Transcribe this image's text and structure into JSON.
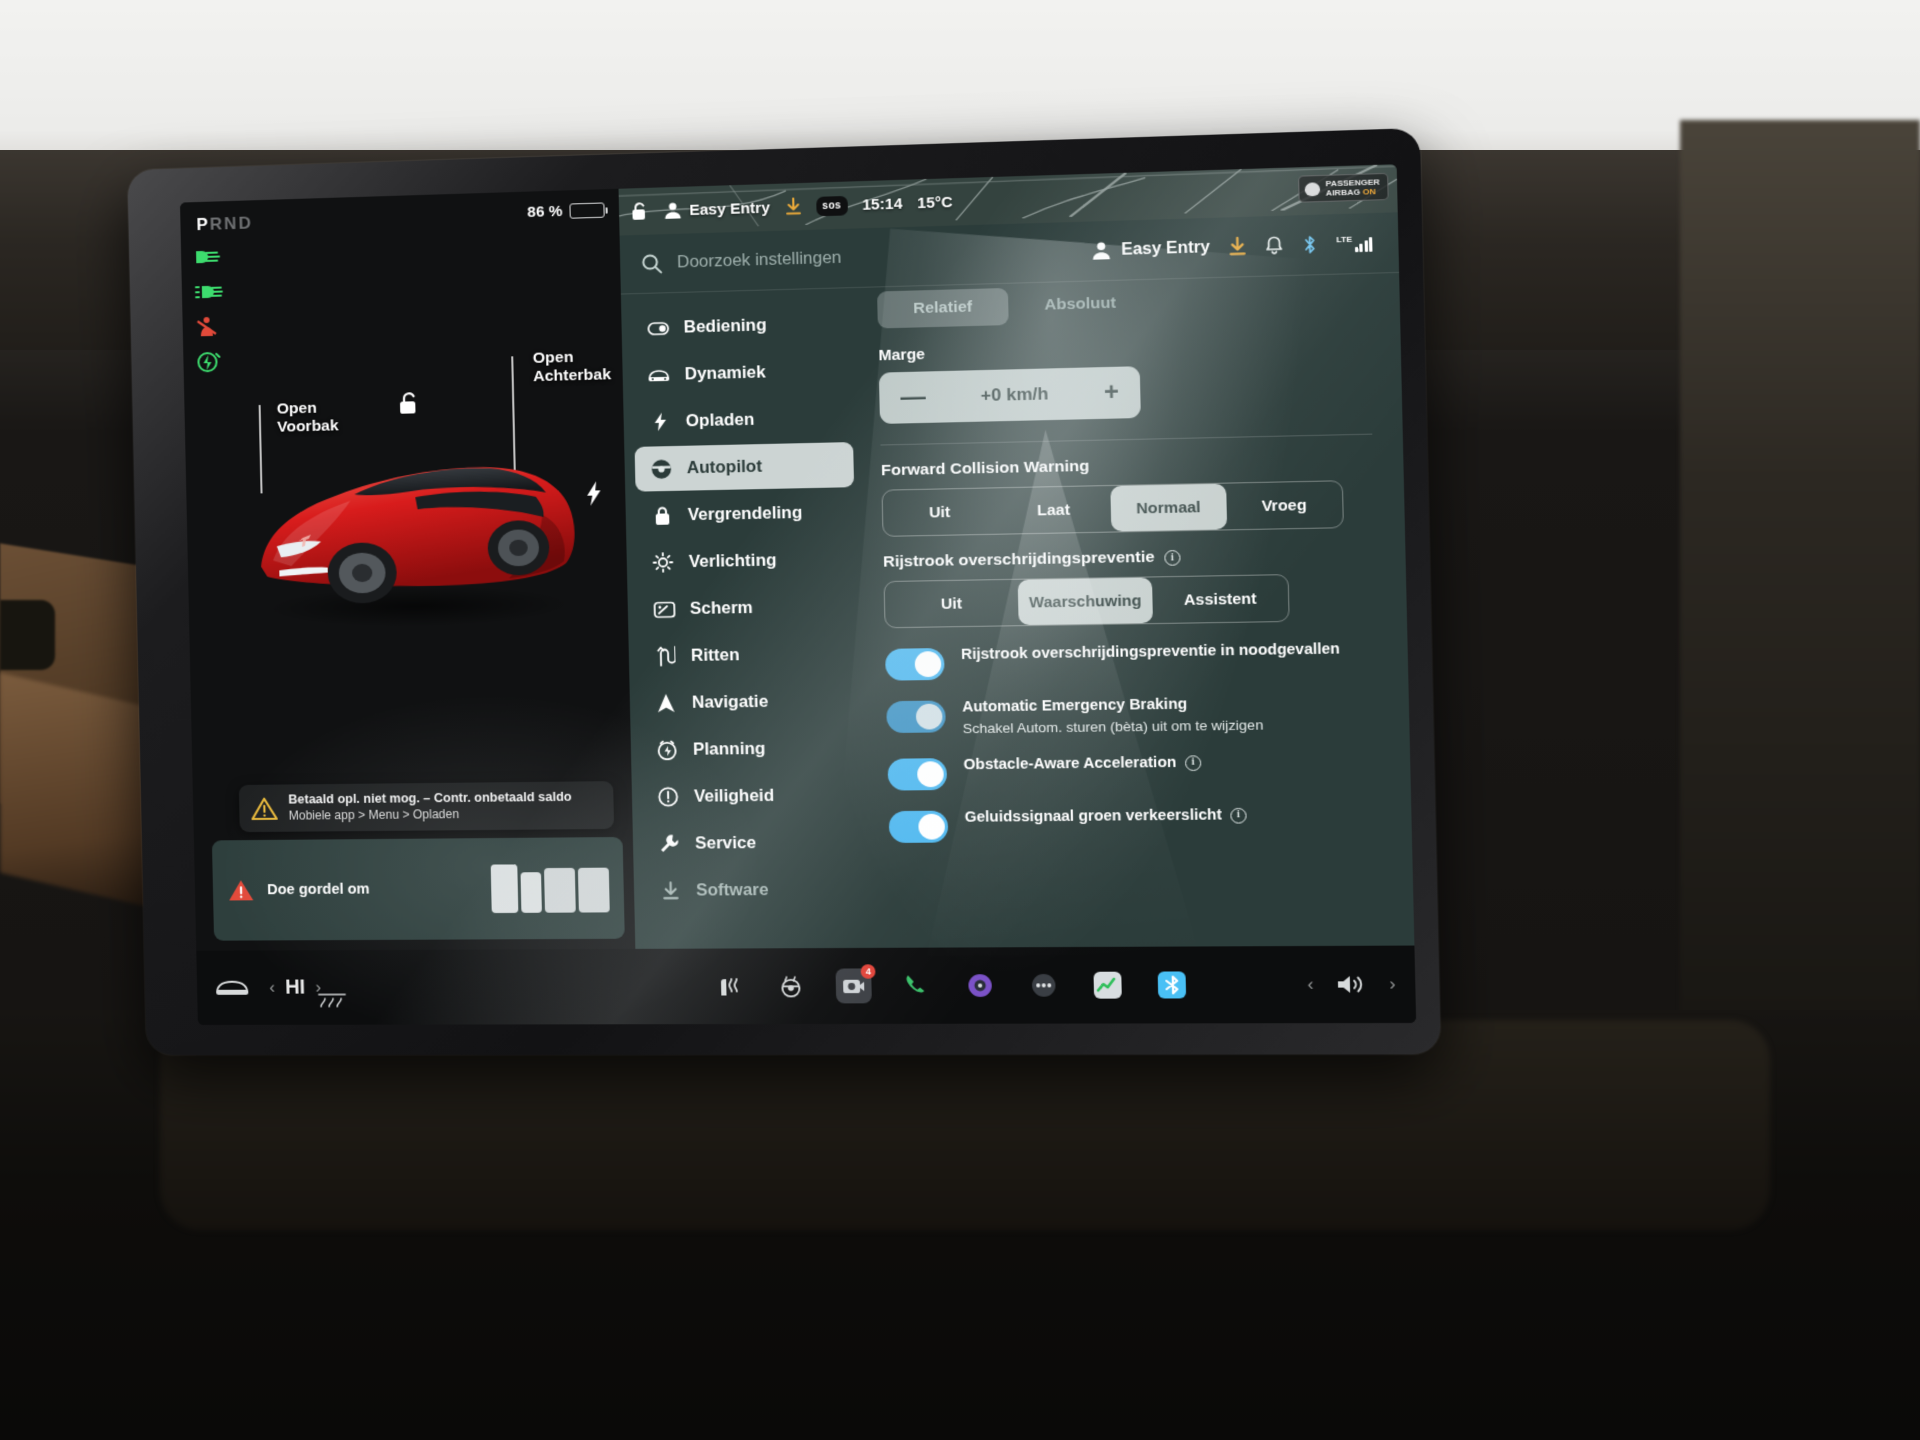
{
  "vehicle_status": {
    "gear_p": "P",
    "gear_rnd": "RND",
    "battery_percent": "86 %"
  },
  "telltales": [
    {
      "name": "low-beam-headlight-indicator",
      "color": "#3ddc6e"
    },
    {
      "name": "auto-highbeam-indicator",
      "color": "#3ddc6e"
    },
    {
      "name": "seatbelt-warning-indicator",
      "color": "#e24a3a"
    },
    {
      "name": "regen-power-limited-indicator",
      "color": "#3ddc6e"
    }
  ],
  "left_pane": {
    "callouts": [
      {
        "label_line1": "Open",
        "label_line2": "Voorbak"
      },
      {
        "label_line1": "Open",
        "label_line2": "Achterbak"
      }
    ],
    "toast": {
      "title": "Betaald opl. niet mog. – Contr. onbetaald saldo",
      "subtitle": "Mobiele app > Menu > Opladen"
    },
    "seatbelt_card": {
      "label": "Doe gordel om"
    }
  },
  "map_strip": {
    "easy_entry": "Easy Entry",
    "sos": "sos",
    "time": "15:14",
    "temperature": "15°C",
    "airbag_badge_line1": "PASSENGER",
    "airbag_badge_line2": "AIRBAG",
    "airbag_badge_state": "ON"
  },
  "settings_header": {
    "search_placeholder": "Doorzoek instellingen",
    "profile": "Easy Entry",
    "network_label": "LTE"
  },
  "nav": {
    "items": [
      {
        "label": "Bediening",
        "icon": "toggle-icon",
        "active": false
      },
      {
        "label": "Dynamiek",
        "icon": "car-front-icon",
        "active": false
      },
      {
        "label": "Opladen",
        "icon": "bolt-icon",
        "active": false
      },
      {
        "label": "Autopilot",
        "icon": "steering-wheel-icon",
        "active": true
      },
      {
        "label": "Vergrendeling",
        "icon": "lock-icon",
        "active": false
      },
      {
        "label": "Verlichting",
        "icon": "sun-icon",
        "active": false
      },
      {
        "label": "Scherm",
        "icon": "display-icon",
        "active": false
      },
      {
        "label": "Ritten",
        "icon": "route-icon",
        "active": false
      },
      {
        "label": "Navigatie",
        "icon": "navigation-icon",
        "active": false
      },
      {
        "label": "Planning",
        "icon": "clock-bolt-icon",
        "active": false
      },
      {
        "label": "Veiligheid",
        "icon": "alert-circle-icon",
        "active": false
      },
      {
        "label": "Service",
        "icon": "wrench-icon",
        "active": false
      },
      {
        "label": "Software",
        "icon": "download-icon",
        "active": false
      }
    ]
  },
  "panel": {
    "mode_tabs": [
      {
        "label": "Relatief",
        "active": true
      },
      {
        "label": "Absoluut",
        "active": false
      }
    ],
    "margin": {
      "label": "Marge",
      "value": "+0 km/h",
      "minus": "—",
      "plus": "+"
    },
    "fcw": {
      "title": "Forward Collision Warning",
      "options": [
        {
          "label": "Uit",
          "active": false
        },
        {
          "label": "Laat",
          "active": false
        },
        {
          "label": "Normaal",
          "active": true
        },
        {
          "label": "Vroeg",
          "active": false
        }
      ]
    },
    "lane_departure": {
      "title": "Rijstrook overschrijdingspreventie",
      "options": [
        {
          "label": "Uit",
          "active": false
        },
        {
          "label": "Waarschuwing",
          "active": true
        },
        {
          "label": "Assistent",
          "active": false
        }
      ]
    },
    "toggles": [
      {
        "label": "Rijstrook overschrijdingspreventie in noodgevallen",
        "sub": "",
        "on": true,
        "dim": false,
        "info": false
      },
      {
        "label": "Automatic Emergency Braking",
        "sub": "Schakel Autom. sturen (bèta) uit om te wijzigen",
        "on": true,
        "dim": true,
        "info": false
      },
      {
        "label": "Obstacle-Aware Acceleration",
        "sub": "",
        "on": true,
        "dim": false,
        "info": true
      },
      {
        "label": "Geluidssignaal groen verkeerslicht",
        "sub": "",
        "on": true,
        "dim": false,
        "info": true
      }
    ]
  },
  "dock": {
    "car_icon": "car-icon",
    "fan_prev": "‹",
    "fan_level": "HI",
    "fan_next": "›",
    "apps": [
      {
        "name": "seat-heater-icon"
      },
      {
        "name": "steering-wheel-heater-icon"
      },
      {
        "name": "camera-icon",
        "badge": "4"
      },
      {
        "name": "phone-icon"
      },
      {
        "name": "media-icon"
      },
      {
        "name": "apps-more-icon"
      },
      {
        "name": "energy-icon"
      },
      {
        "name": "bluetooth-app-icon"
      }
    ],
    "volume_prev": "‹",
    "volume_icon": "volume-icon",
    "volume_next": "›"
  },
  "colors": {
    "accent_blue": "#4cb7f0",
    "panel_green": "#2b3c3a",
    "warning_yellow": "#e8b93c",
    "danger_red": "#e24a3a",
    "telltale_green": "#3ddc6e"
  }
}
